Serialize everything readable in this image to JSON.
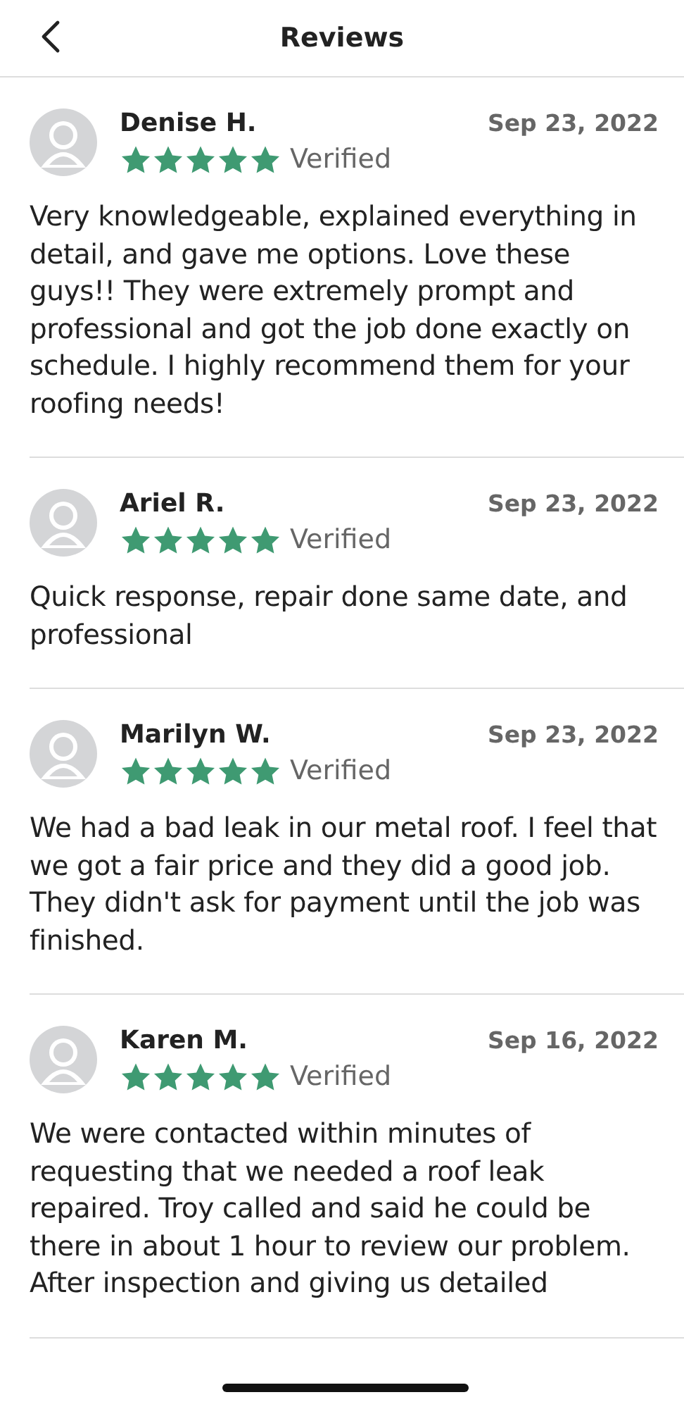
{
  "header": {
    "title": "Reviews"
  },
  "reviews": [
    {
      "name": "Denise H.",
      "date": "Sep 23, 2022",
      "stars": 5,
      "verified": "Verified",
      "text": "Very knowledgeable, explained everything in detail, and gave me options.  Love these guys!! They were extremely prompt and professional and got the job done exactly on schedule. I highly recommend them for your roofing needs!"
    },
    {
      "name": "Ariel R.",
      "date": "Sep 23, 2022",
      "stars": 5,
      "verified": "Verified",
      "text": "Quick response, repair done same date, and professional"
    },
    {
      "name": "Marilyn W.",
      "date": "Sep 23, 2022",
      "stars": 5,
      "verified": "Verified",
      "text": "We had a bad leak in our metal roof. I feel that we got a fair price and they did a good job. They didn't ask for payment until the job was finished."
    },
    {
      "name": "Karen M.",
      "date": "Sep 16, 2022",
      "stars": 5,
      "verified": "Verified",
      "text": "We were contacted within minutes of requesting that we needed a roof leak repaired.  Troy called and said he could be there in about 1 hour to review our problem. After inspection and giving us detailed"
    }
  ]
}
